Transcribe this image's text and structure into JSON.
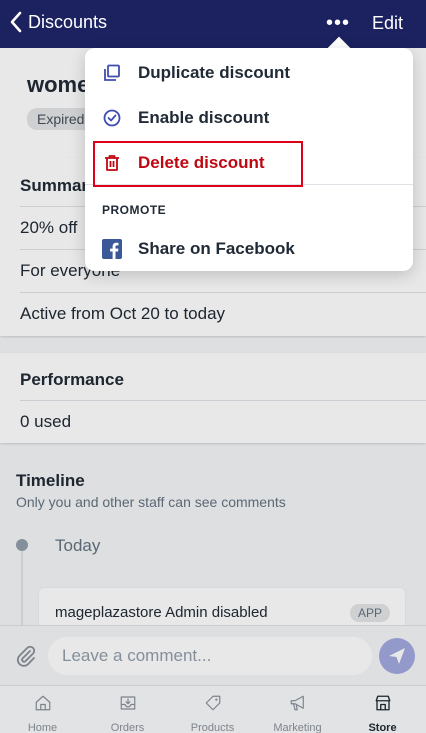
{
  "navbar": {
    "back_label": "Discounts",
    "more_label": "•••",
    "edit_label": "Edit"
  },
  "discount": {
    "title": "women",
    "status": "Expired"
  },
  "summary": {
    "title": "Summary",
    "rows": [
      "20% off",
      "For everyone",
      "Active from Oct 20 to today"
    ]
  },
  "performance": {
    "title": "Performance",
    "used": "0 used"
  },
  "timeline": {
    "title": "Timeline",
    "subtitle": "Only you and other staff can see comments",
    "date": "Today",
    "event_text": "mageplazastore Admin disabled",
    "event_badge": "APP"
  },
  "comment": {
    "placeholder": "Leave a comment..."
  },
  "tabs": [
    {
      "label": "Home",
      "icon": "home-icon"
    },
    {
      "label": "Orders",
      "icon": "orders-icon"
    },
    {
      "label": "Products",
      "icon": "tag-icon"
    },
    {
      "label": "Marketing",
      "icon": "megaphone-icon"
    },
    {
      "label": "Store",
      "icon": "store-icon"
    }
  ],
  "menu": {
    "items": [
      {
        "label": "Duplicate discount",
        "icon": "duplicate-icon"
      },
      {
        "label": "Enable discount",
        "icon": "check-circle-icon"
      },
      {
        "label": "Delete discount",
        "icon": "trash-icon"
      }
    ],
    "section_label": "PROMOTE",
    "promote_items": [
      {
        "label": "Share on Facebook",
        "icon": "facebook-icon"
      }
    ]
  },
  "colors": {
    "nav_bg": "#1c2260",
    "danger": "#bf0711",
    "highlight": "#e0001a",
    "facebook": "#3b5998",
    "send_bg": "#a3a9e0",
    "accent": "#5c6ac4"
  }
}
